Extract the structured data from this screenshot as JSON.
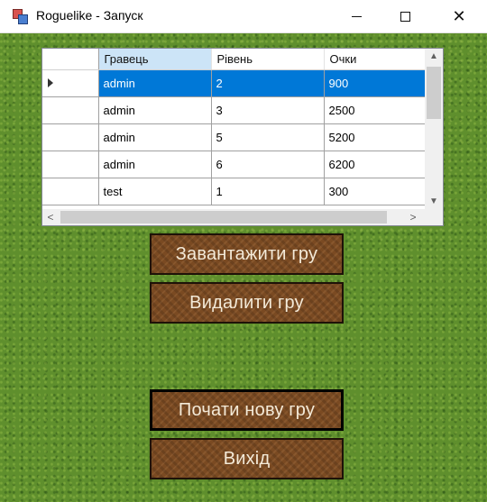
{
  "window": {
    "title": "Roguelike - Запуск",
    "minimize_label": "—",
    "maximize_label": "☐",
    "close_label": "✕"
  },
  "grid": {
    "columns": [
      "Гравець",
      "Рівень",
      "Очки"
    ],
    "rows": [
      {
        "player": "admin",
        "level": "2",
        "score": "900",
        "selected": true
      },
      {
        "player": "admin",
        "level": "3",
        "score": "2500"
      },
      {
        "player": "admin",
        "level": "5",
        "score": "5200"
      },
      {
        "player": "admin",
        "level": "6",
        "score": "6200"
      },
      {
        "player": "test",
        "level": "1",
        "score": "300"
      }
    ],
    "scroll_up": "▲",
    "scroll_down": "▼",
    "scroll_left": "<",
    "scroll_right": ">"
  },
  "buttons": {
    "load": "Завантажити гру",
    "delete": "Видалити гру",
    "new_game": "Почати нову гру",
    "exit": "Вихід"
  },
  "colors": {
    "selection": "#0078d7",
    "grass": "#5f8f2d",
    "button_wood": "#7a4a22",
    "button_text": "#f4ead8"
  }
}
